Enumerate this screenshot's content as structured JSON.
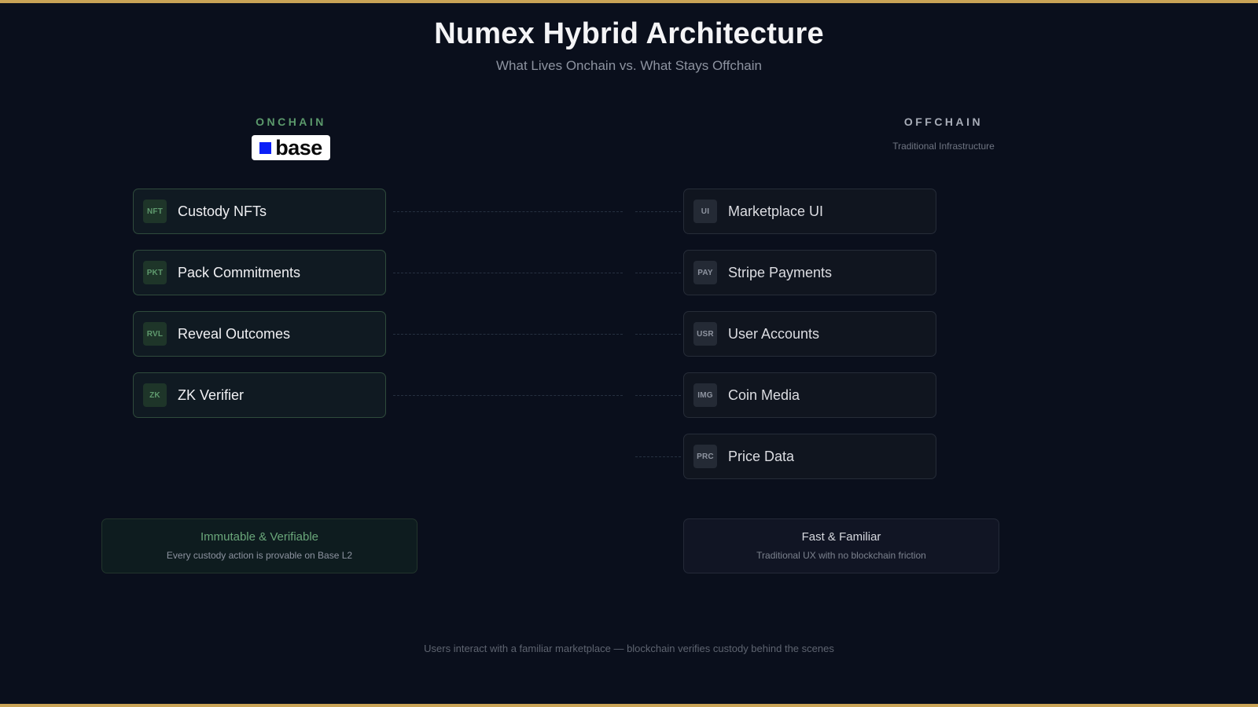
{
  "title": "Numex Hybrid Architecture",
  "subtitle": "What Lives Onchain vs. What Stays Offchain",
  "onchain": {
    "heading": "ONCHAIN",
    "logo_text": "base",
    "logo_color": "#0b1ff7",
    "items": [
      {
        "badge": "NFT",
        "label": "Custody NFTs"
      },
      {
        "badge": "PKT",
        "label": "Pack Commitments"
      },
      {
        "badge": "RVL",
        "label": "Reveal Outcomes"
      },
      {
        "badge": "ZK",
        "label": "ZK Verifier"
      }
    ],
    "summary": {
      "title": "Immutable & Verifiable",
      "desc": "Every custody action is provable on Base L2"
    },
    "accent": "#5c9a6c"
  },
  "offchain": {
    "heading": "OFFCHAIN",
    "subheading": "Traditional Infrastructure",
    "items": [
      {
        "badge": "UI",
        "label": "Marketplace UI"
      },
      {
        "badge": "PAY",
        "label": "Stripe Payments"
      },
      {
        "badge": "USR",
        "label": "User Accounts"
      },
      {
        "badge": "IMG",
        "label": "Coin Media"
      },
      {
        "badge": "PRC",
        "label": "Price Data"
      }
    ],
    "summary": {
      "title": "Fast & Familiar",
      "desc": "Traditional UX with no blockchain friction"
    }
  },
  "footer": "Users interact with a familiar marketplace — blockchain verifies custody behind the scenes",
  "colors": {
    "gold": "#c9a356",
    "background": "#0a0f1c"
  }
}
